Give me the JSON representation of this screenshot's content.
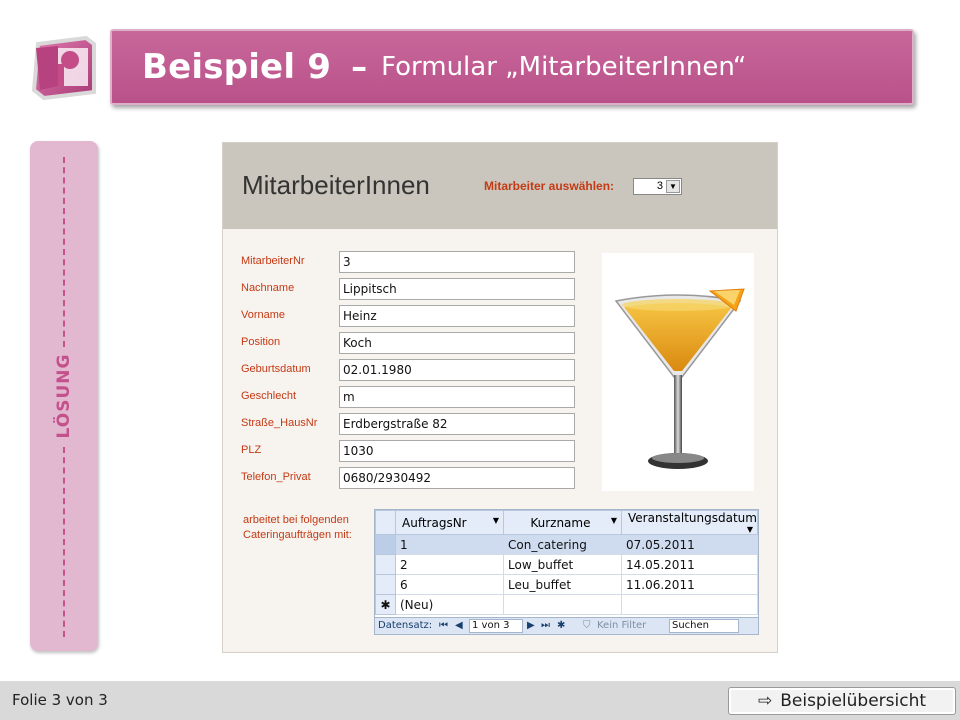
{
  "header": {
    "title_main": "Beispiel 9",
    "title_dash": "–",
    "title_sub": "Formular „MitarbeiterInnen“"
  },
  "sidebar": {
    "label": "LÖSUNG"
  },
  "form": {
    "title": "MitarbeiterInnen",
    "select_label": "Mitarbeiter auswählen:",
    "select_value": "3",
    "fields": [
      {
        "label": "MitarbeiterNr",
        "value": "3"
      },
      {
        "label": "Nachname",
        "value": "Lippitsch"
      },
      {
        "label": "Vorname",
        "value": "Heinz"
      },
      {
        "label": "Position",
        "value": "Koch"
      },
      {
        "label": "Geburtsdatum",
        "value": "02.01.1980"
      },
      {
        "label": "Geschlecht",
        "value": "m"
      },
      {
        "label": "Straße_HausNr",
        "value": "Erdbergstraße 82"
      },
      {
        "label": "PLZ",
        "value": "1030"
      },
      {
        "label": "Telefon_Privat",
        "value": "0680/2930492"
      }
    ],
    "photo_icon": "cocktail-glass-image",
    "subform_label_1": "arbeitet bei folgenden",
    "subform_label_2": "Cateringaufträgen mit:",
    "subform": {
      "headers": [
        "AuftragsNr",
        "Kurzname",
        "Veranstaltungsdatum"
      ],
      "rows": [
        [
          "1",
          "Con_catering",
          "07.05.2011"
        ],
        [
          "2",
          "Low_buffet",
          "14.05.2011"
        ],
        [
          "6",
          "Leu_buffet",
          "11.06.2011"
        ]
      ],
      "new_row_symbol": "✱",
      "new_row_label": "(Neu)"
    },
    "nav": {
      "label": "Datensatz:",
      "position": "1 von 3",
      "filter": "Kein Filter",
      "search": "Suchen"
    }
  },
  "footer": {
    "slide_info": "Folie 3 von 3",
    "overview_arrow": "⇨",
    "overview_label": "Beispielübersicht"
  },
  "colors": {
    "banner": "#c0608f",
    "sidebar": "#e2b8d0",
    "label_red": "#c43a14"
  }
}
